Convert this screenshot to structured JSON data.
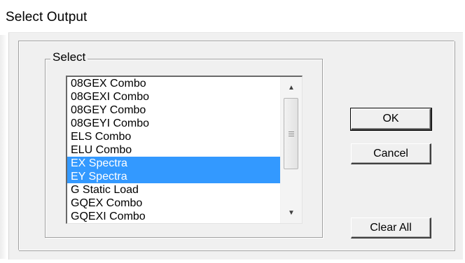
{
  "dialog": {
    "title": "Select Output"
  },
  "group": {
    "label": "Select"
  },
  "list": {
    "items": [
      {
        "label": "08GEX Combo",
        "selected": false
      },
      {
        "label": "08GEXI Combo",
        "selected": false
      },
      {
        "label": "08GEY Combo",
        "selected": false
      },
      {
        "label": "08GEYI Combo",
        "selected": false
      },
      {
        "label": "ELS Combo",
        "selected": false
      },
      {
        "label": "ELU Combo",
        "selected": false
      },
      {
        "label": "EX Spectra",
        "selected": true
      },
      {
        "label": "EY Spectra",
        "selected": true
      },
      {
        "label": "G Static Load",
        "selected": false
      },
      {
        "label": "GQEX Combo",
        "selected": false
      },
      {
        "label": "GQEXI Combo",
        "selected": false
      }
    ],
    "selection_color": "#3399ff",
    "scrollbar": {
      "up_icon": "arrow-up-icon",
      "down_icon": "arrow-down-icon",
      "thumb_icon": "grip-icon"
    }
  },
  "buttons": {
    "ok": "OK",
    "cancel": "Cancel",
    "clear_all": "Clear All"
  }
}
